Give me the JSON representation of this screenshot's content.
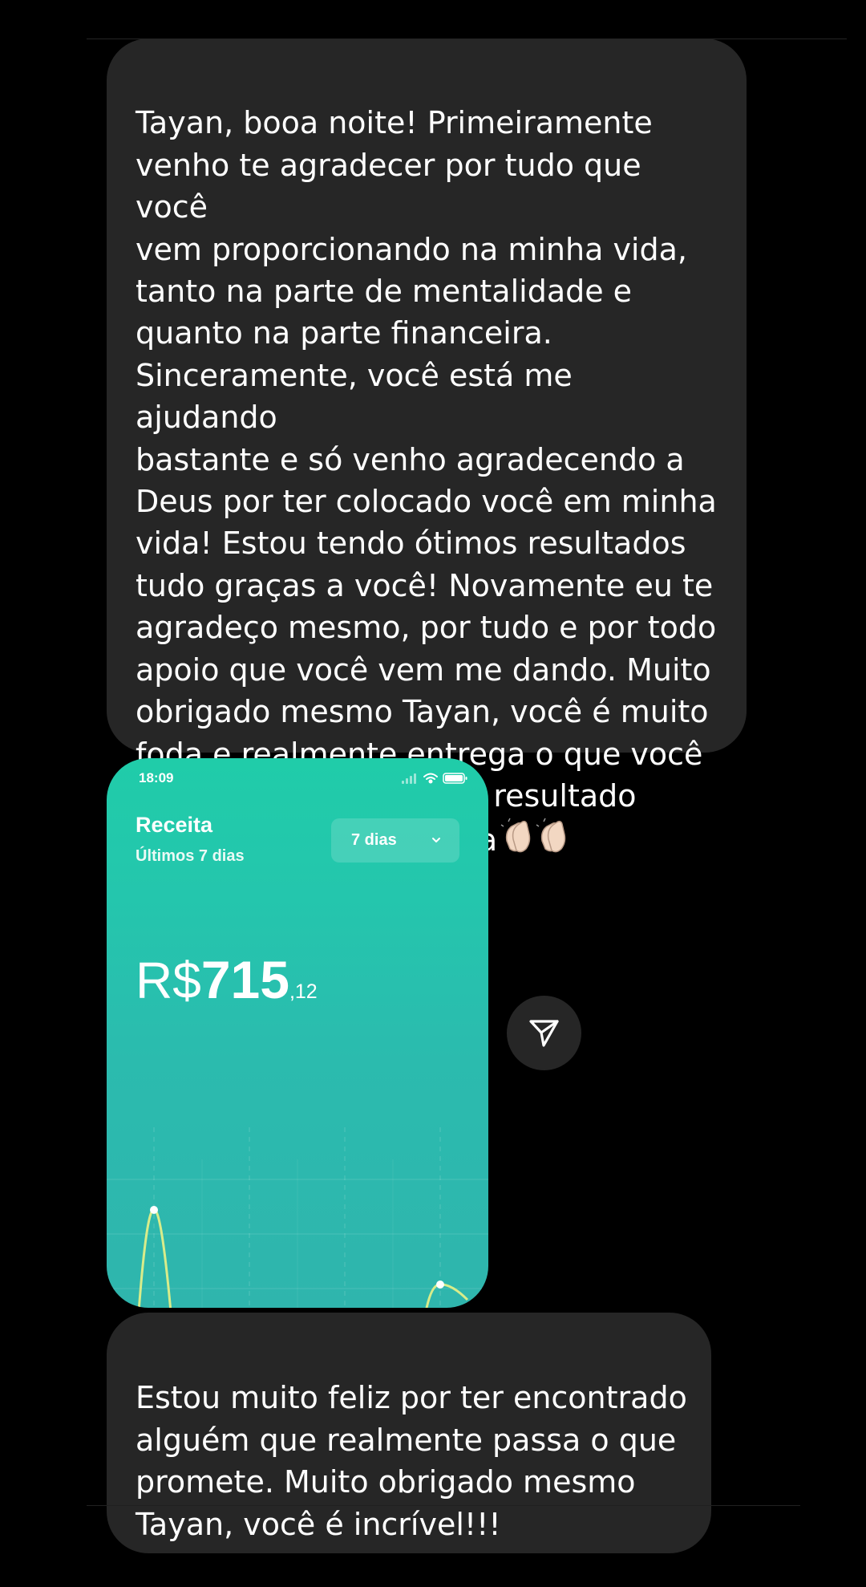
{
  "messages": [
    {
      "text": "Tayan, booa noite! Primeiramente\nvenho te agradecer por tudo que você\nvem proporcionando na minha vida,\ntanto na parte de mentalidade e\nquanto na parte financeira.\nSinceramente, você está me ajudando\nbastante e só venho agradecendo a\nDeus por ter colocado você em minha\nvida! Estou tendo ótimos resultados\ntudo graças a você! Novamente eu te\nagradeço mesmo, por tudo e por todo\napoio que você vem me dando. Muito\nobrigado mesmo Tayan, você é muito\nfoda e realmente entrega o que você\npromete!!! Segue meu resultado\nsomente dessa semana",
      "emoji": "clapping-hands-icon x2"
    },
    {
      "text": "Estou muito feliz por ter encontrado\nalguém que realmente passa o que\npromete. Muito obrigado mesmo\nTayan, você é incrível!!!"
    }
  ],
  "screenshot": {
    "status_time": "18:09",
    "title": "Receita",
    "subtitle": "Últimos 7 dias",
    "period_selected": "7 dias",
    "currency": "R$",
    "amount_integer": "715",
    "amount_cents": ",12"
  },
  "icons": {
    "share": "paper-plane-icon",
    "status": [
      "signal-icon",
      "wifi-icon",
      "battery-icon"
    ],
    "chevron": "chevron-down-icon"
  },
  "colors": {
    "background": "#000000",
    "bubble": "#262626",
    "accent_green": "#20cca9",
    "chart_line": "#d8ec8a"
  }
}
